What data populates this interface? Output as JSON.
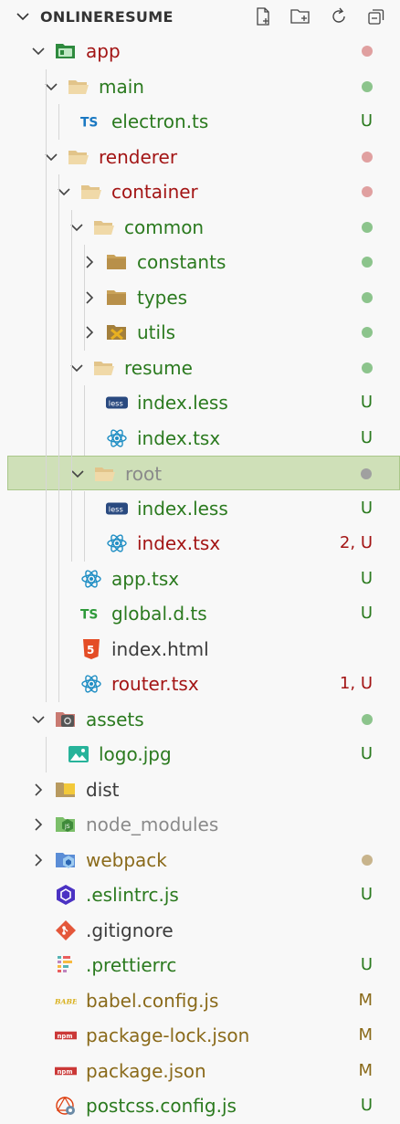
{
  "explorer": {
    "title": "ONLINERESUME",
    "actions": [
      "new-file",
      "new-folder",
      "refresh",
      "collapse-all"
    ]
  },
  "colors": {
    "modified_red_dot": "#e0a0a0",
    "untracked_green_dot": "#8cc48c",
    "ignored_grey_dot": "#a0a0a0",
    "tan_dot": "#c8b48c",
    "selection_bg": "#cfe0b8"
  },
  "tree": [
    {
      "label": "app",
      "depth": 0,
      "type": "folder",
      "open": true,
      "icon": "app-folder-icon",
      "color": "red",
      "status": "dot-red"
    },
    {
      "label": "main",
      "depth": 1,
      "type": "folder",
      "open": true,
      "icon": "folder-open-icon",
      "color": "green",
      "status": "dot-green"
    },
    {
      "label": "electron.ts",
      "depth": 2,
      "type": "file",
      "icon": "typescript-icon",
      "color": "green",
      "status": "U"
    },
    {
      "label": "renderer",
      "depth": 1,
      "type": "folder",
      "open": true,
      "icon": "folder-open-icon",
      "color": "red",
      "status": "dot-red"
    },
    {
      "label": "container",
      "depth": 2,
      "type": "folder",
      "open": true,
      "icon": "folder-open-icon",
      "color": "red",
      "status": "dot-red"
    },
    {
      "label": "common",
      "depth": 3,
      "type": "folder",
      "open": true,
      "icon": "folder-open-icon",
      "color": "green",
      "status": "dot-green"
    },
    {
      "label": "constants",
      "depth": 4,
      "type": "folder",
      "open": false,
      "icon": "folder-closed-icon",
      "color": "green",
      "status": "dot-green"
    },
    {
      "label": "types",
      "depth": 4,
      "type": "folder",
      "open": false,
      "icon": "folder-closed-icon",
      "color": "green",
      "status": "dot-green"
    },
    {
      "label": "utils",
      "depth": 4,
      "type": "folder",
      "open": false,
      "icon": "utils-folder-icon",
      "color": "green",
      "status": "dot-green"
    },
    {
      "label": "resume",
      "depth": 3,
      "type": "folder",
      "open": true,
      "icon": "folder-open-icon",
      "color": "green",
      "status": "dot-green"
    },
    {
      "label": "index.less",
      "depth": 4,
      "type": "file",
      "icon": "less-icon",
      "color": "green",
      "status": "U"
    },
    {
      "label": "index.tsx",
      "depth": 4,
      "type": "file",
      "icon": "react-icon",
      "color": "green",
      "status": "U"
    },
    {
      "label": "root",
      "depth": 3,
      "type": "folder",
      "open": true,
      "icon": "folder-open-icon",
      "color": "grey",
      "status": "dot-grey",
      "selected": true
    },
    {
      "label": "index.less",
      "depth": 4,
      "type": "file",
      "icon": "less-icon",
      "color": "green",
      "status": "U"
    },
    {
      "label": "index.tsx",
      "depth": 4,
      "type": "file",
      "icon": "react-icon",
      "color": "red",
      "status": "2, U"
    },
    {
      "label": "app.tsx",
      "depth": 2,
      "type": "file",
      "icon": "react-icon",
      "color": "green",
      "status": "U"
    },
    {
      "label": "global.d.ts",
      "depth": 2,
      "type": "file",
      "icon": "typescript-def-icon",
      "color": "green",
      "status": "U"
    },
    {
      "label": "index.html",
      "depth": 2,
      "type": "file",
      "icon": "html5-icon",
      "color": "plain",
      "status": ""
    },
    {
      "label": "router.tsx",
      "depth": 2,
      "type": "file",
      "icon": "react-icon",
      "color": "red",
      "status": "1, U"
    },
    {
      "label": "assets",
      "depth": 0,
      "type": "folder",
      "open": true,
      "icon": "assets-folder-icon",
      "color": "green",
      "status": "dot-green"
    },
    {
      "label": "logo.jpg",
      "depth": 1,
      "type": "file",
      "icon": "image-icon",
      "color": "green",
      "status": "U"
    },
    {
      "label": "dist",
      "depth": 0,
      "type": "folder",
      "open": false,
      "icon": "dist-folder-icon",
      "color": "plain",
      "status": ""
    },
    {
      "label": "node_modules",
      "depth": 0,
      "type": "folder",
      "open": false,
      "icon": "node-folder-icon",
      "color": "grey",
      "status": ""
    },
    {
      "label": "webpack",
      "depth": 0,
      "type": "folder",
      "open": false,
      "icon": "webpack-folder-icon",
      "color": "yellow",
      "status": "dot-tan"
    },
    {
      "label": ".eslintrc.js",
      "depth": 0,
      "type": "file",
      "icon": "eslint-icon",
      "color": "green",
      "status": "U"
    },
    {
      "label": ".gitignore",
      "depth": 0,
      "type": "file",
      "icon": "git-icon",
      "color": "plain",
      "status": ""
    },
    {
      "label": ".prettierrc",
      "depth": 0,
      "type": "file",
      "icon": "prettier-icon",
      "color": "green",
      "status": "U"
    },
    {
      "label": "babel.config.js",
      "depth": 0,
      "type": "file",
      "icon": "babel-icon",
      "color": "yellow",
      "status": "M"
    },
    {
      "label": "package-lock.json",
      "depth": 0,
      "type": "file",
      "icon": "npm-icon",
      "color": "yellow",
      "status": "M"
    },
    {
      "label": "package.json",
      "depth": 0,
      "type": "file",
      "icon": "npm-icon",
      "color": "yellow",
      "status": "M"
    },
    {
      "label": "postcss.config.js",
      "depth": 0,
      "type": "file",
      "icon": "postcss-icon",
      "color": "green",
      "status": "U"
    }
  ]
}
